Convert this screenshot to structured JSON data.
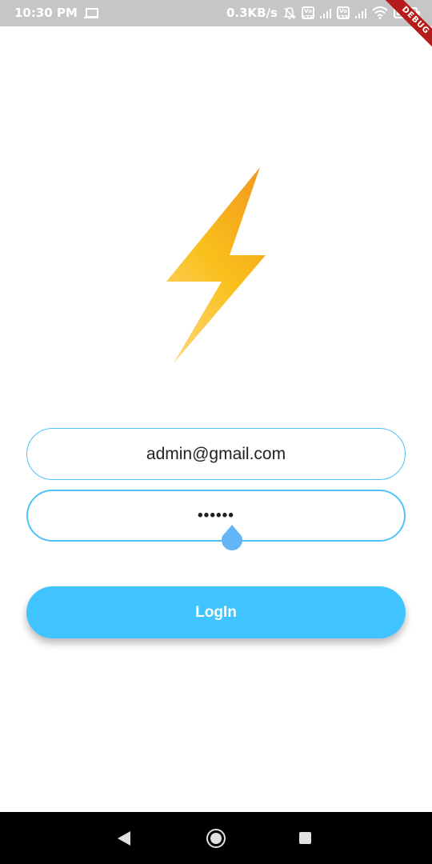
{
  "status_bar": {
    "time": "10:30 PM",
    "network_speed": "0.3KB/s",
    "icons": [
      "laptop-icon",
      "notifications-off-icon",
      "volte-icon",
      "signal-icon",
      "volte-icon",
      "signal-icon",
      "wifi-icon",
      "battery-icon"
    ],
    "volte_label": "VoLTE",
    "battery_level": 0.9
  },
  "debug_banner": {
    "label": "DEBUG"
  },
  "logo": {
    "icon": "lightning-bolt-icon",
    "colors": [
      "#f9c01b",
      "#f5a623"
    ]
  },
  "form": {
    "email": {
      "value": "admin@gmail.com",
      "border_color": "#4fc3f7"
    },
    "password": {
      "value": "••••••",
      "border_color": "#4fc3f7",
      "handle_color": "#64b5f6"
    }
  },
  "login_button": {
    "label": "LogIn",
    "color": "#40c4ff"
  },
  "nav_bar": {
    "icons": [
      "back-icon",
      "home-icon",
      "recents-icon"
    ]
  }
}
